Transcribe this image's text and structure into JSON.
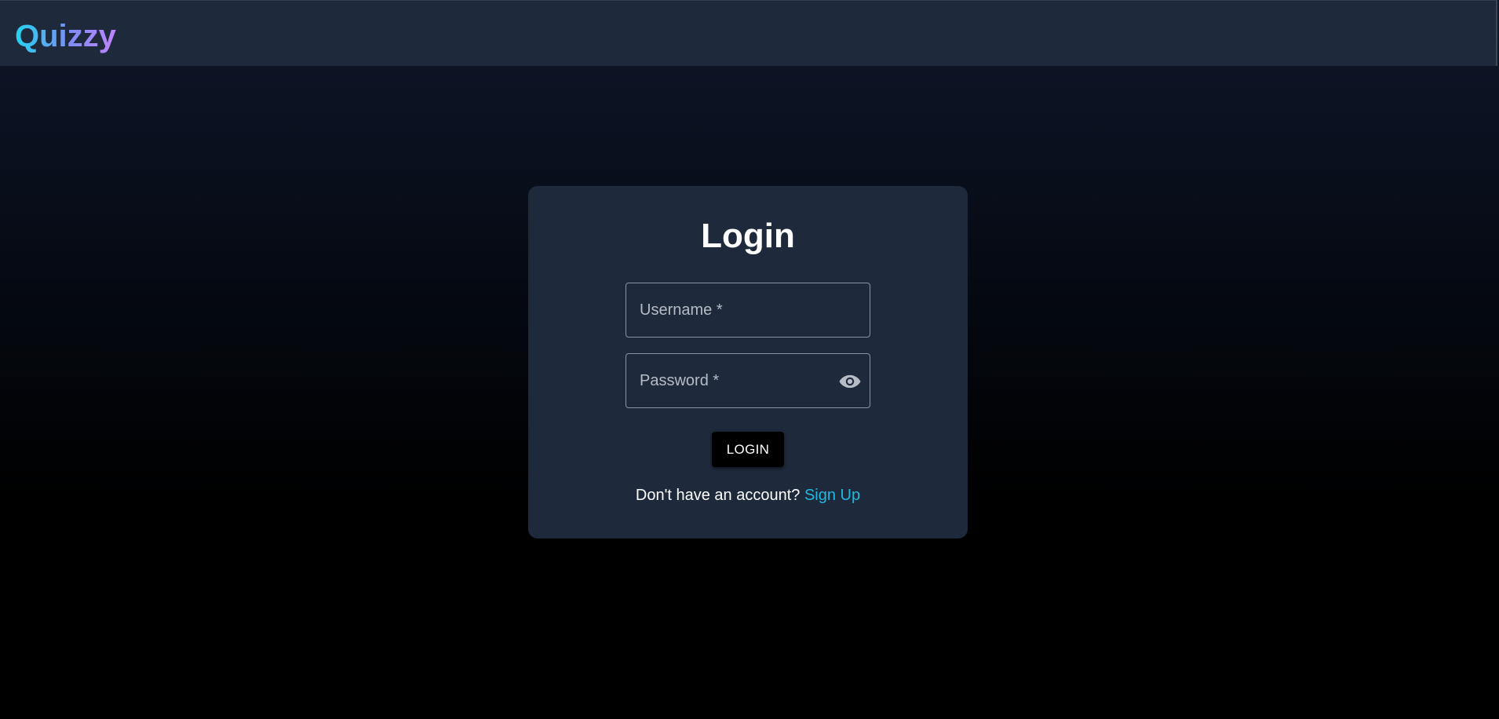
{
  "app": {
    "name": "Quizzy"
  },
  "login_card": {
    "title": "Login",
    "username_placeholder": "Username *",
    "password_placeholder": "Password *",
    "password_toggle_icon": "eye-icon",
    "login_button_label": "LOGIN",
    "signup_prompt": "Don't have an account?",
    "signup_link_label": "Sign Up"
  },
  "colors": {
    "navbar_bg": "#1e293b",
    "card_bg": "#1e293b",
    "page_bg_top": "#0f172a",
    "page_bg_bottom": "#000000",
    "logo_gradient_start": "#22d3ee",
    "logo_gradient_end": "#c084fc",
    "link": "#22b8e0",
    "button_bg": "#000000"
  }
}
